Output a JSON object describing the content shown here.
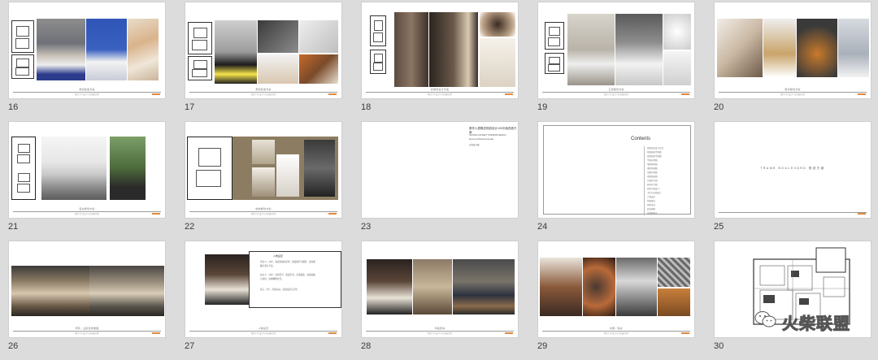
{
  "slides": [
    {
      "number": "16",
      "caption": "规划改造方案",
      "subcaption": "我们门户设计与空间研究院"
    },
    {
      "number": "17",
      "caption": "规划改造方案",
      "subcaption": "我们门户设计与空间研究院"
    },
    {
      "number": "18",
      "caption": "衣帽间设计方案",
      "subcaption": "我们门户设计与空间研究院"
    },
    {
      "number": "19",
      "caption": "卫浴规划方案",
      "subcaption": "我们门户设计与空间研究院"
    },
    {
      "number": "20",
      "caption": "厨房规划方案",
      "subcaption": "我们门户设计与空间研究院"
    },
    {
      "number": "21",
      "caption": "露台规划方案",
      "subcaption": "我们门户设计与空间研究院"
    },
    {
      "number": "22",
      "caption": "收纳规划方案",
      "subcaption": "我们门户设计与空间研究院"
    },
    {
      "number": "23",
      "caption": "",
      "subcaption": ""
    },
    {
      "number": "24",
      "caption": "",
      "subcaption": ""
    },
    {
      "number": "25",
      "caption": "",
      "subcaption": ""
    },
    {
      "number": "26",
      "caption": "原有 - 主卧室效果图",
      "subcaption": "我们门户设计与空间研究院"
    },
    {
      "number": "27",
      "caption": "人物设定",
      "subcaption": "我们门户设计与空间研究院"
    },
    {
      "number": "28",
      "caption": "风格意向",
      "subcaption": "我们门户设计与空间研究院"
    },
    {
      "number": "29",
      "caption": "材质 / 色彩",
      "subcaption": "我们门户设计与空间研究院"
    },
    {
      "number": "30",
      "caption": "",
      "subcaption": ""
    }
  ],
  "slide23": {
    "title": "原作人居概念规划设计100平面改造方案",
    "line2": "XIAOJIE CONCEPT INTERIOR DESIGN",
    "line3": "Renew Architecture Design",
    "line4": "方案设计版"
  },
  "slide24": {
    "title": "Contents",
    "items": [
      "规划改造设计方案",
      "原始结构平面图",
      "规划改造平面图",
      "平面布置图",
      "墙体拆除图",
      "墙体新建图",
      "顶面布置图",
      "地面铺装图",
      "立面索引图",
      "家具尺寸图",
      "厨房立面设计",
      "卫生间立面设计",
      "人物设定",
      "风格意向",
      "材质色彩",
      "软装搭配",
      "效果图展示"
    ]
  },
  "slide25": {
    "title": "TRAME BOULEVARD 规划方案"
  },
  "slide27": {
    "heading": "人物设定",
    "p1": "男主人：33岁，资深金融分析师，热爱旅行与摄影，喜欢收藏红酒与手表。",
    "p2": "女主人：30岁，时尚买手，热爱生活，注重品质，喜欢瑜伽与烘焙，追求精致生活。",
    "p3": "孩子：5岁，活泼好动，喜欢绘画与音乐。"
  },
  "watermark": {
    "text": "火柴联盟"
  }
}
